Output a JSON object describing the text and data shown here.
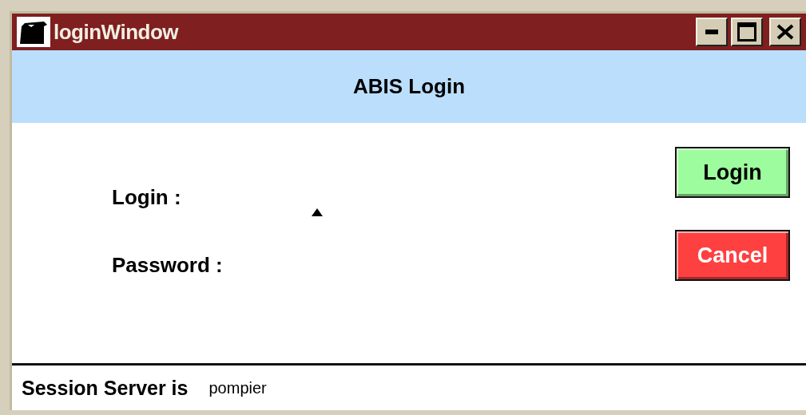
{
  "window": {
    "title": "loginWindow"
  },
  "header": {
    "title": "ABIS Login"
  },
  "fields": [
    {
      "label": "Login :"
    },
    {
      "label": "Password :"
    }
  ],
  "buttons": [
    {
      "label": "Login",
      "color": "#9dfc9d"
    },
    {
      "label": "Cancel",
      "color": "#ff4040"
    }
  ],
  "status_bar": {
    "label": "Session Server is",
    "value": "pompier"
  }
}
